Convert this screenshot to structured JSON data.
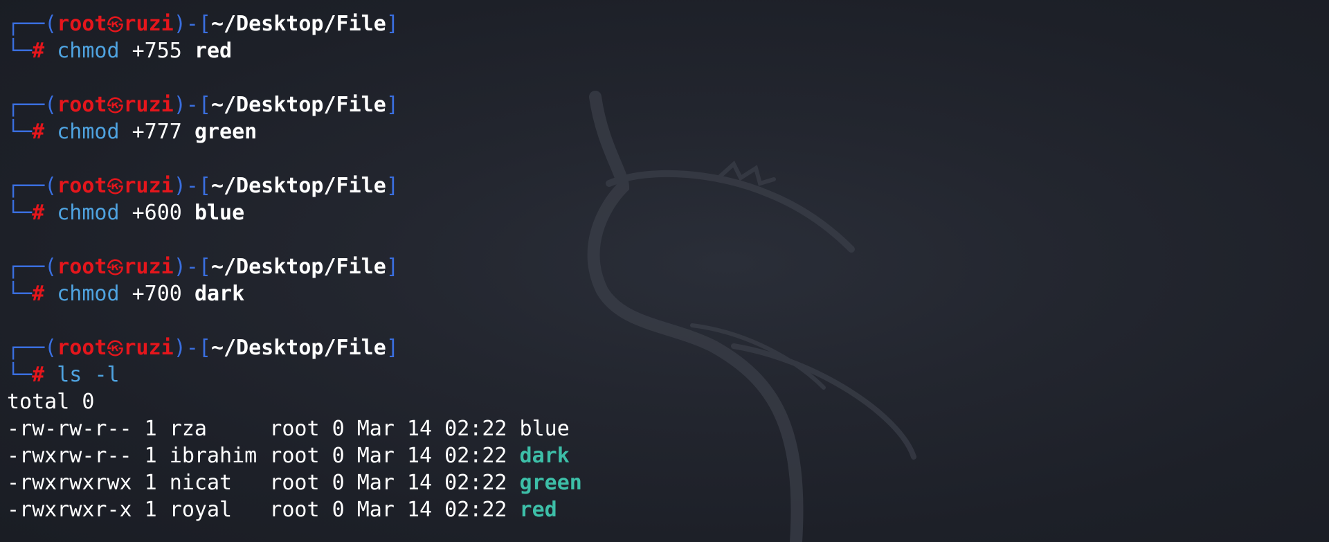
{
  "prompt": {
    "open": "┌──(",
    "user": "root",
    "skull_icon": "skull-icon",
    "host": "ruzi",
    "mid": ")-[",
    "path": "~/Desktop/File",
    "close": "]",
    "second_line": "└─",
    "hash": "#"
  },
  "colors": {
    "frame": "#3a6fe0",
    "user": "#e5161c",
    "command": "#4fa3e0",
    "executable": "#3dbfa8",
    "text": "#ffffff",
    "background": "#1c1f26"
  },
  "commands": [
    {
      "cmd": "chmod",
      "num": "+755",
      "target": "red"
    },
    {
      "cmd": "chmod",
      "num": "+777",
      "target": "green"
    },
    {
      "cmd": "chmod",
      "num": "+600",
      "target": "blue"
    },
    {
      "cmd": "chmod",
      "num": "+700",
      "target": "dark"
    },
    {
      "cmd": "ls",
      "num": "-l",
      "target": ""
    }
  ],
  "output": {
    "total": "total 0",
    "rows": [
      {
        "prefix": "-rw-rw-r-- 1 rza     root 0 Mar 14 02:22 ",
        "name": "blue",
        "executable": false
      },
      {
        "prefix": "-rwxrw-r-- 1 ibrahim root 0 Mar 14 02:22 ",
        "name": "dark",
        "executable": true
      },
      {
        "prefix": "-rwxrwxrwx 1 nicat   root 0 Mar 14 02:22 ",
        "name": "green",
        "executable": true
      },
      {
        "prefix": "-rwxrwxr-x 1 royal   root 0 Mar 14 02:22 ",
        "name": "red",
        "executable": true
      }
    ]
  }
}
